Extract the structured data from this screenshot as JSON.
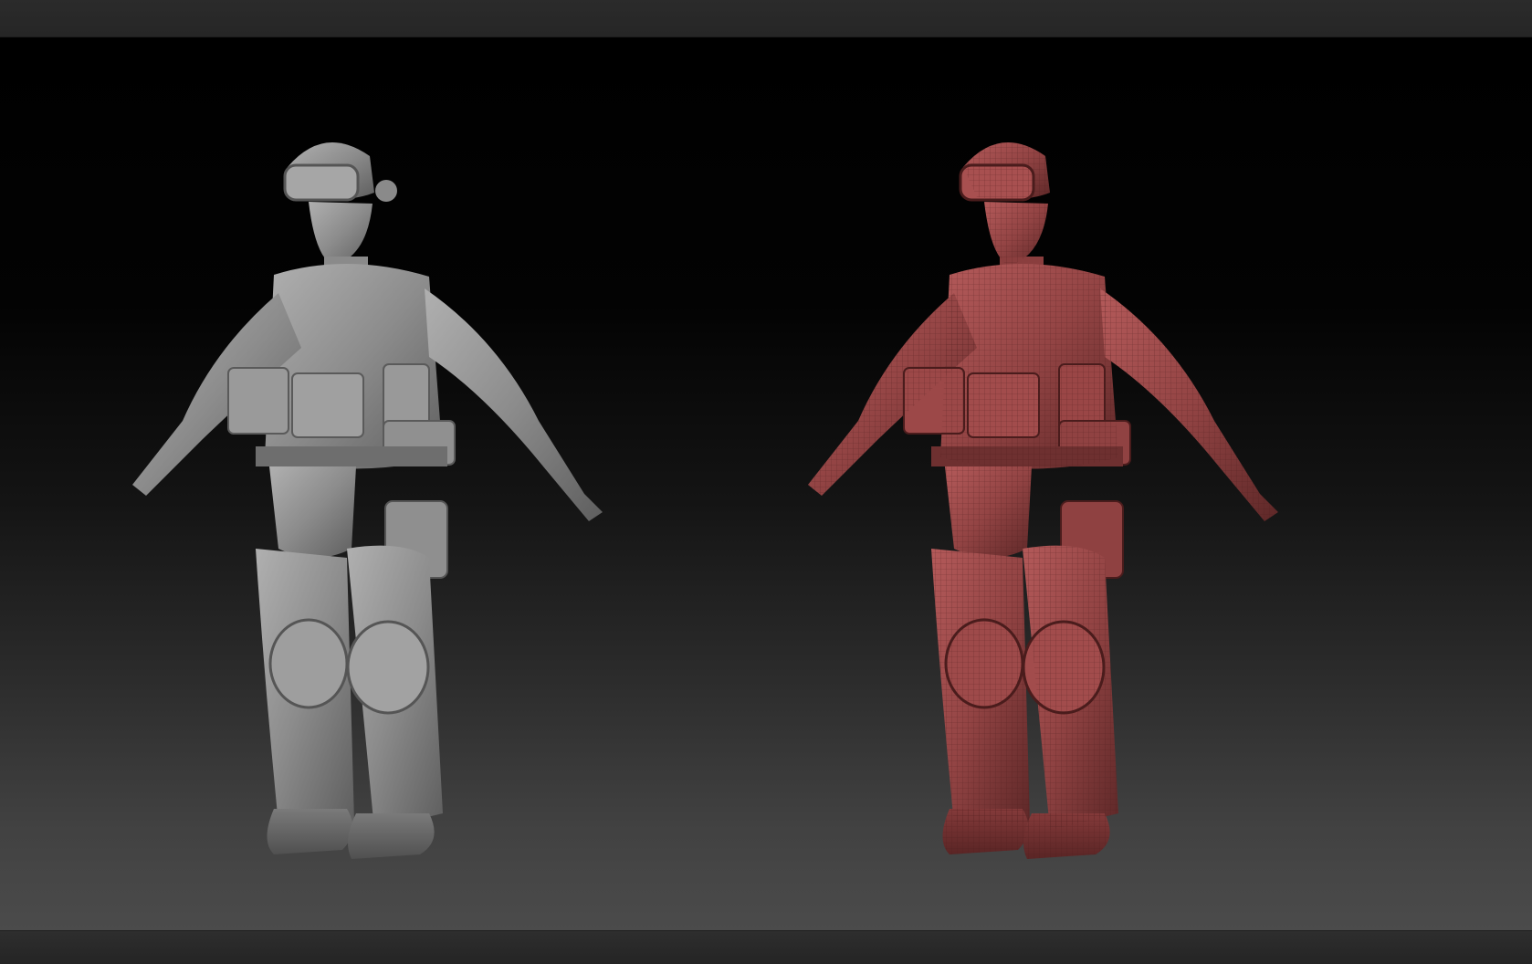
{
  "viewport": {
    "background_top": "#000000",
    "background_bottom": "#4b4b4b"
  },
  "models": [
    {
      "name": "sculpted-soldier-model",
      "material": "clay",
      "color": "#8e8e8e",
      "shading": "#6a6a6a",
      "highlight": "#b4b4b4"
    },
    {
      "name": "wireframe-soldier-model",
      "material": "polypaint-wireframe",
      "color": "#9a4848",
      "shading": "#6e2f2f",
      "highlight": "#c06666"
    }
  ],
  "chrome": {
    "top_bar_color": "#282828",
    "bottom_bar_color": "#2a2a2a"
  }
}
